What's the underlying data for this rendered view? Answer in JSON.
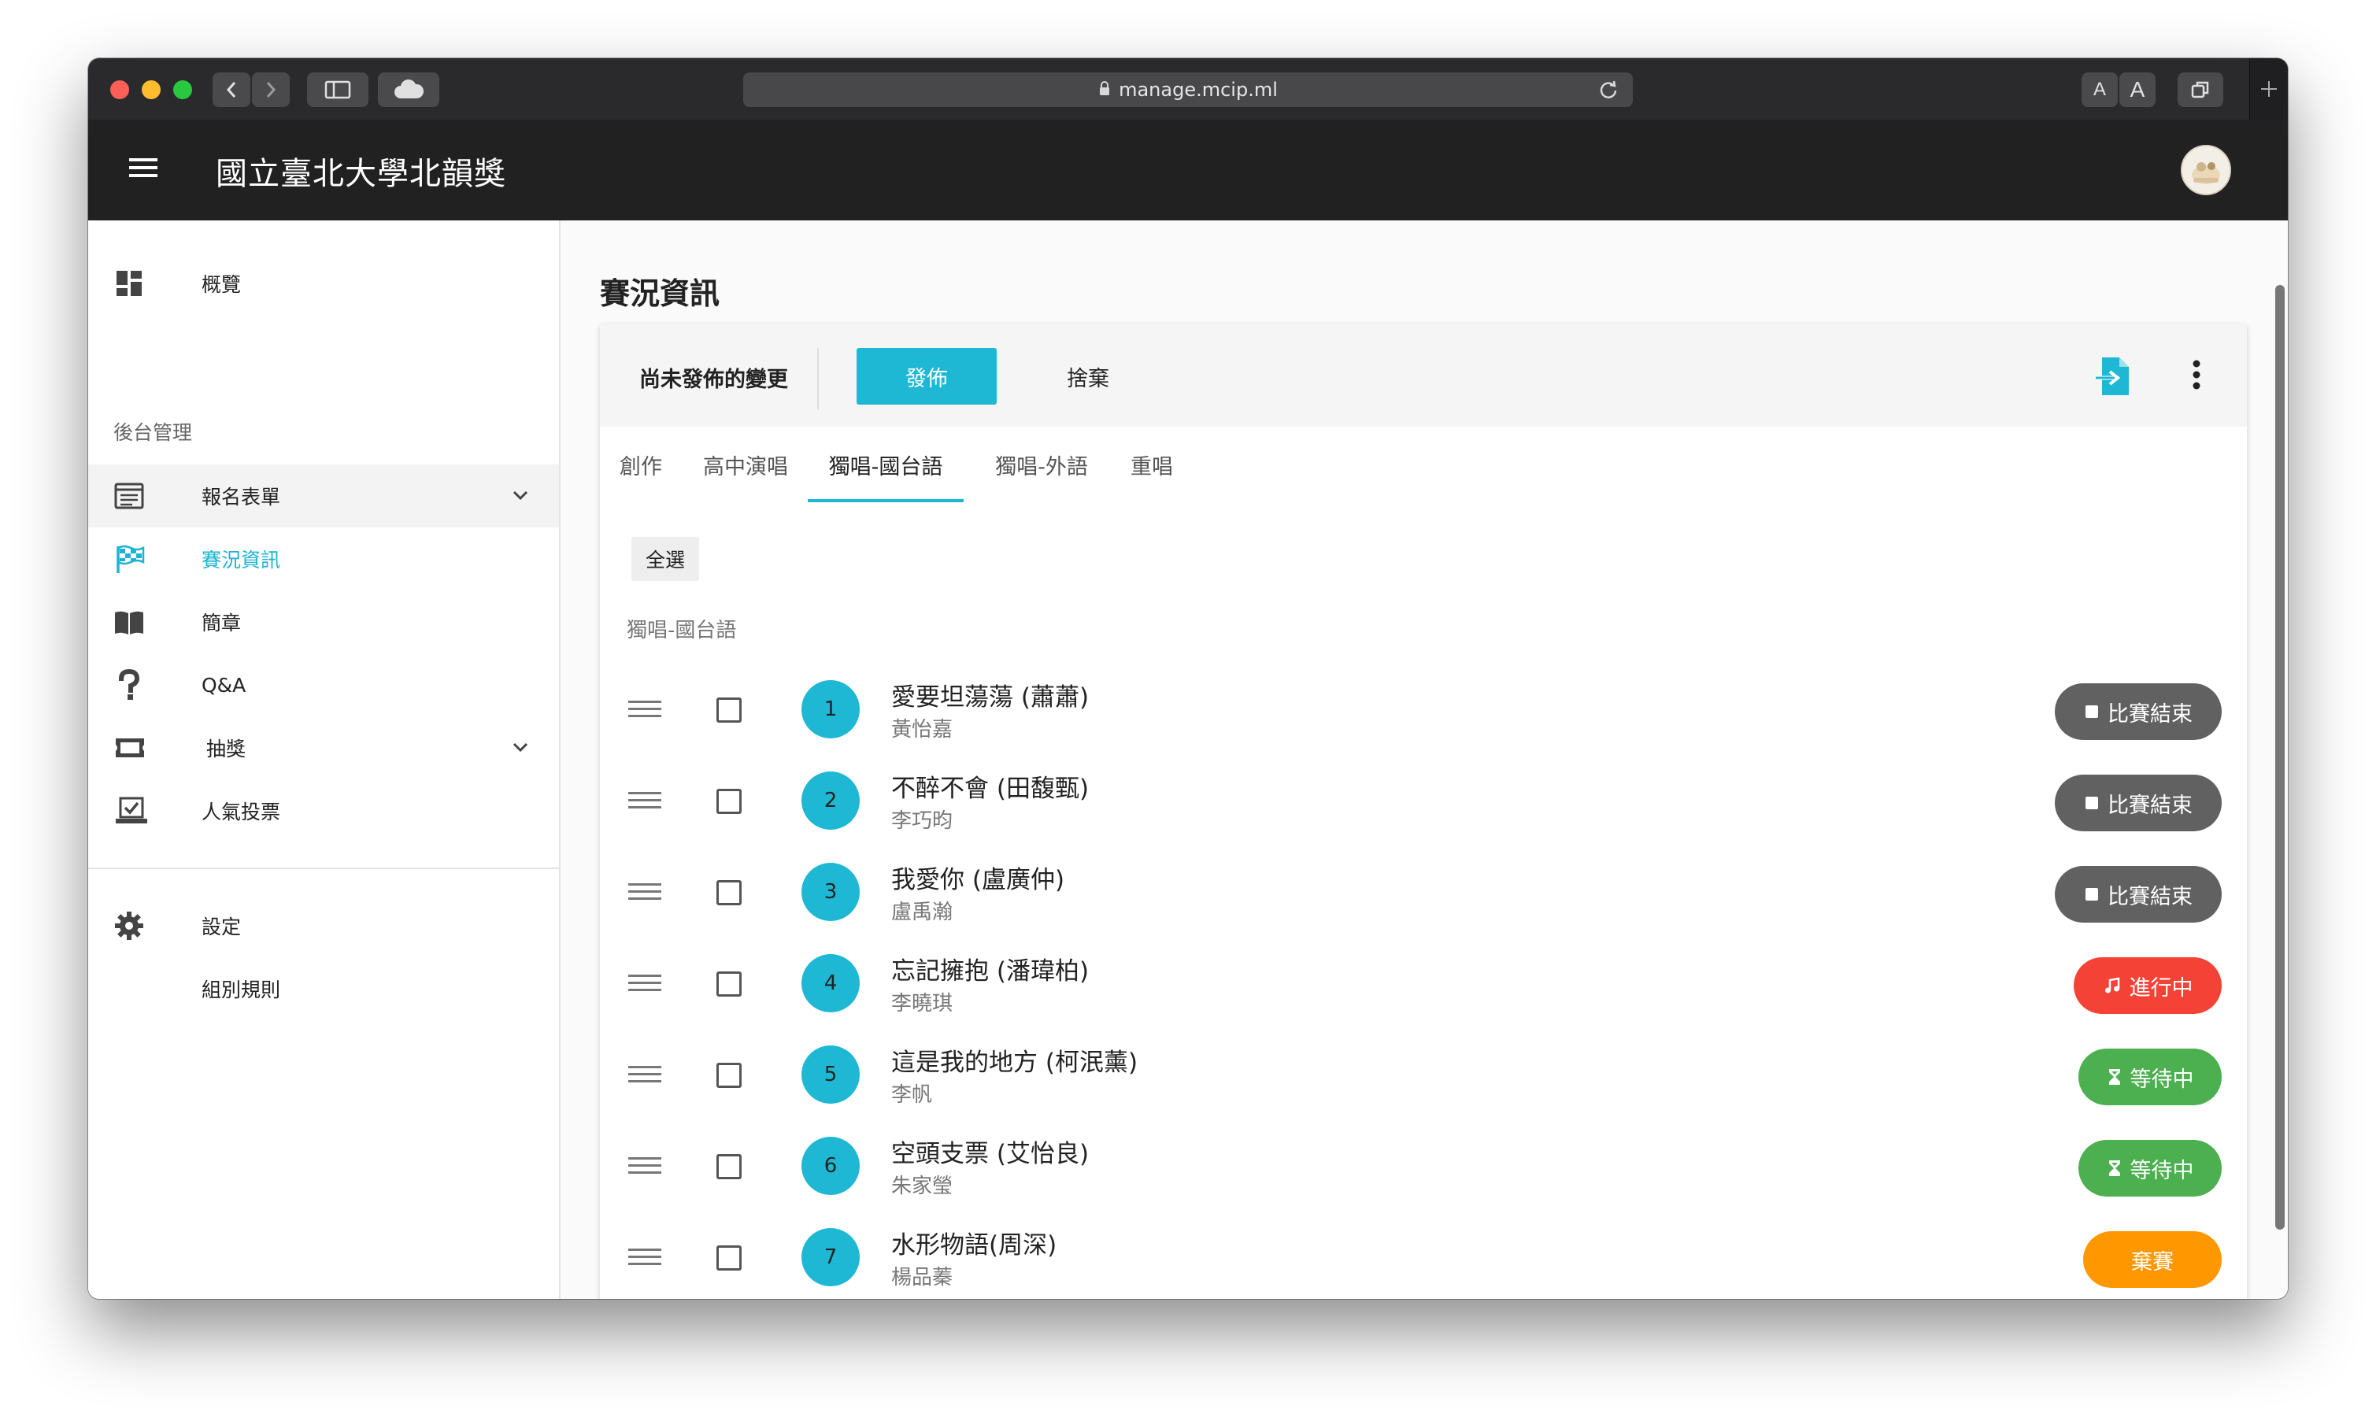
{
  "browser": {
    "url": "manage.mcip.ml",
    "text_size_small": "A",
    "text_size_large": "A"
  },
  "app": {
    "title": "國立臺北大學北韻獎"
  },
  "sidebar": {
    "overview": "概覽",
    "admin_header": "後台管理",
    "items": [
      {
        "label": "報名表單",
        "icon": "form-icon",
        "expandable": true
      },
      {
        "label": "賽況資訊",
        "icon": "checkered-flag-icon",
        "active": true
      },
      {
        "label": "簡章",
        "icon": "book-icon"
      },
      {
        "label": "Q&A",
        "icon": "question-icon"
      },
      {
        "label": "抽獎",
        "icon": "ticket-icon",
        "expandable": true
      },
      {
        "label": "人氣投票",
        "icon": "vote-icon"
      }
    ],
    "settings": "設定",
    "group_rules": "組別規則"
  },
  "main": {
    "page_title": "賽況資訊",
    "toolbar": {
      "unpublished_label": "尚未發佈的變更",
      "publish_label": "發佈",
      "discard_label": "捨棄"
    },
    "tabs": [
      "創作",
      "高中演唱",
      "獨唱-國台語",
      "獨唱-外語",
      "重唱"
    ],
    "active_tab": 2,
    "select_all_label": "全選",
    "section_label": "獨唱-國台語",
    "rows": [
      {
        "num": "1",
        "song": "愛要坦蕩蕩 (蕭蕭)",
        "singer": "黃怡嘉",
        "status": "比賽結束",
        "status_type": "done"
      },
      {
        "num": "2",
        "song": "不醉不會 (田馥甄)",
        "singer": "李巧昀",
        "status": "比賽結束",
        "status_type": "done"
      },
      {
        "num": "3",
        "song": "我愛你 (盧廣仲)",
        "singer": "盧禹瀚",
        "status": "比賽結束",
        "status_type": "done"
      },
      {
        "num": "4",
        "song": "忘記擁抱 (潘瑋柏)",
        "singer": "李曉琪",
        "status": "進行中",
        "status_type": "live"
      },
      {
        "num": "5",
        "song": "這是我的地方 (柯泯薰)",
        "singer": "李帆",
        "status": "等待中",
        "status_type": "wait"
      },
      {
        "num": "6",
        "song": "空頭支票 (艾怡良)",
        "singer": "朱家瑩",
        "status": "等待中",
        "status_type": "wait"
      },
      {
        "num": "7",
        "song": "水形物語(周深)",
        "singer": "楊品蓁",
        "status": "棄賽",
        "status_type": "quit"
      }
    ]
  },
  "colors": {
    "accent": "#1fb8d4",
    "header": "#212121",
    "status_done": "#616161",
    "status_live": "#f44336",
    "status_wait": "#4caf50",
    "status_quit": "#ff9800"
  }
}
